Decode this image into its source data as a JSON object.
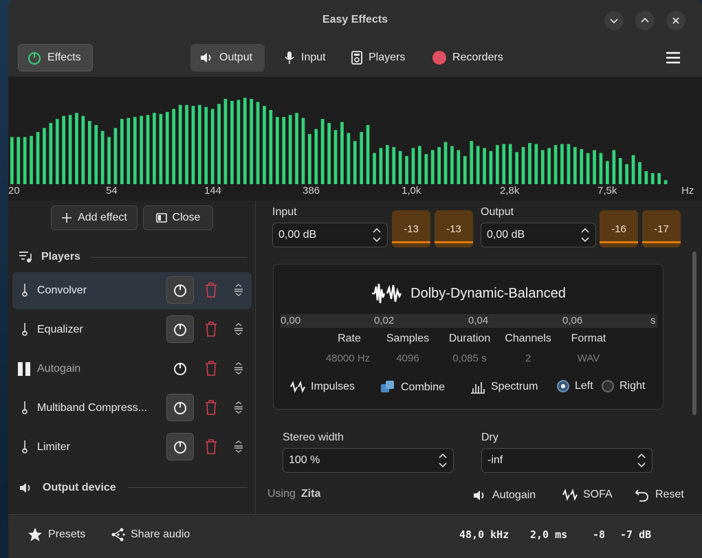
{
  "window": {
    "title": "Easy Effects"
  },
  "colors": {
    "accent_green": "#34d27a",
    "meter_orange": "#e07a10",
    "recorders_red": "#e05060",
    "trash_red": "#d04050"
  },
  "toolbar": {
    "effects_label": "Effects",
    "tabs": [
      {
        "label": "Output",
        "icon": "speaker-icon",
        "active": true
      },
      {
        "label": "Input",
        "icon": "microphone-icon",
        "active": false
      },
      {
        "label": "Players",
        "icon": "player-icon",
        "active": false
      },
      {
        "label": "Recorders",
        "icon": "record-dot-icon",
        "active": false
      }
    ]
  },
  "spectrum": {
    "freq_labels": [
      "20",
      "54",
      "144",
      "386",
      "1,0k",
      "2,8k",
      "7,5k",
      "Hz"
    ],
    "levels": [
      0.47,
      0.47,
      0.47,
      0.48,
      0.52,
      0.56,
      0.61,
      0.65,
      0.68,
      0.69,
      0.71,
      0.68,
      0.63,
      0.59,
      0.53,
      0.47,
      0.56,
      0.65,
      0.66,
      0.67,
      0.68,
      0.69,
      0.71,
      0.7,
      0.72,
      0.75,
      0.79,
      0.79,
      0.78,
      0.79,
      0.77,
      0.75,
      0.8,
      0.85,
      0.83,
      0.84,
      0.86,
      0.85,
      0.82,
      0.78,
      0.74,
      0.67,
      0.67,
      0.69,
      0.71,
      0.66,
      0.5,
      0.55,
      0.65,
      0.61,
      0.54,
      0.62,
      0.51,
      0.43,
      0.52,
      0.59,
      0.31,
      0.36,
      0.39,
      0.37,
      0.33,
      0.28,
      0.36,
      0.38,
      0.3,
      0.34,
      0.37,
      0.42,
      0.38,
      0.34,
      0.28,
      0.43,
      0.38,
      0.36,
      0.33,
      0.39,
      0.4,
      0.4,
      0.32,
      0.37,
      0.41,
      0.4,
      0.34,
      0.36,
      0.39,
      0.4,
      0.4,
      0.37,
      0.35,
      0.31,
      0.34,
      0.31,
      0.23,
      0.34,
      0.26,
      0.2,
      0.29,
      0.22,
      0.13,
      0.11,
      0.11,
      0.04,
      0.0,
      0.0
    ]
  },
  "left": {
    "add_effect_label": "Add effect",
    "close_label": "Close",
    "players_heading": "Players",
    "plugins": [
      {
        "name": "Convolver",
        "enabled": true,
        "selected": true
      },
      {
        "name": "Equalizer",
        "enabled": true,
        "selected": false
      },
      {
        "name": "Autogain",
        "enabled": false,
        "selected": false
      },
      {
        "name": "Multiband Compress...",
        "enabled": true,
        "selected": false
      },
      {
        "name": "Limiter",
        "enabled": true,
        "selected": false
      }
    ],
    "output_device_heading": "Output device"
  },
  "right": {
    "input_label": "Input",
    "input_value": "0,00 dB",
    "input_meters": [
      "-13",
      "-13"
    ],
    "output_label": "Output",
    "output_value": "0,00 dB",
    "output_meters": [
      "-16",
      "-17"
    ],
    "irfile": {
      "name": "Dolby-Dynamic-Balanced",
      "timeline": [
        "0,00",
        "0,02",
        "0,04",
        "0,06",
        "s"
      ],
      "columns": [
        {
          "label": "Rate",
          "value": "48000 Hz"
        },
        {
          "label": "Samples",
          "value": "4096"
        },
        {
          "label": "Duration",
          "value": "0,085 s"
        },
        {
          "label": "Channels",
          "value": "2"
        },
        {
          "label": "Format",
          "value": "WAV"
        }
      ],
      "impulses_label": "Impulses",
      "combine_label": "Combine",
      "spectrum_label": "Spectrum",
      "left_label": "Left",
      "right_label": "Right",
      "selected_channel": "Left"
    },
    "stereo_width_label": "Stereo width",
    "stereo_width_value": "100 %",
    "dry_label": "Dry",
    "dry_value": "-inf",
    "using_prefix": "Using",
    "using_engine": "Zita",
    "autogain_label": "Autogain",
    "sofa_label": "SOFA",
    "reset_label": "Reset"
  },
  "status": {
    "presets_label": "Presets",
    "share_label": "Share audio",
    "sample_rate": "48,0 kHz",
    "latency": "2,0 ms",
    "level_left": "-8",
    "level_right": "-7 dB"
  }
}
